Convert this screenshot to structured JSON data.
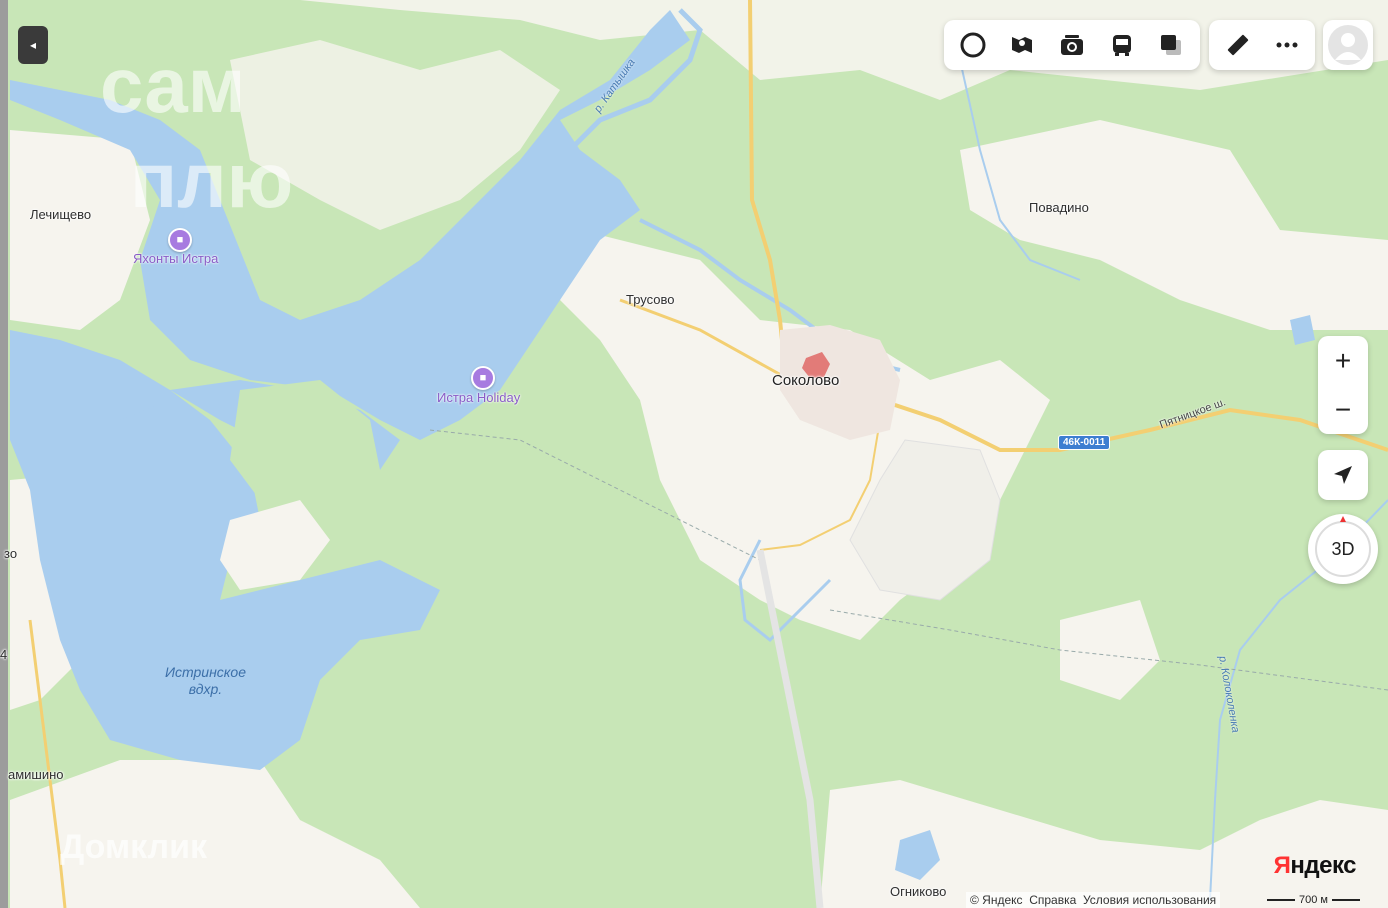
{
  "map": {
    "places": {
      "lechishchevo": "Лечищево",
      "trusovo": "Трусово",
      "sokolovo": "Соколово",
      "povadino": "Повадино",
      "ognikovo": "Огниково",
      "amishino": "амишино",
      "left_partial": "зо",
      "left_digit": "4"
    },
    "pois": {
      "yakhonty": "Яхонты Истра",
      "istra_holiday": "Истра Holiday"
    },
    "water": {
      "reservoir_line1": "Истринское",
      "reservoir_line2": "вдхр.",
      "river_katyshka": "р. Катышка",
      "river_kolokolenka": "р. Колоколенка"
    },
    "roads": {
      "pyatnitskoe": "Пятницкое ш.",
      "badge_46k": "46К-0011"
    },
    "watermarks": {
      "top_line1": "сам",
      "top_line2": "плю",
      "bottom": "Домклик"
    }
  },
  "toolbar": {
    "icons": [
      "alice-icon",
      "panorama-icon",
      "photo-icon",
      "transport-icon",
      "layers-icon"
    ],
    "ruler_icon": "ruler-icon",
    "more_icon": "more-icon",
    "profile_icon": "avatar"
  },
  "controls": {
    "zoom_in": "+",
    "zoom_out": "−",
    "mode_3d": "3D",
    "collapse": "◂"
  },
  "footer": {
    "copyright": "© Яндекс",
    "help": "Справка",
    "terms": "Условия использования",
    "brand": "Яндекс",
    "brand_first": "Я",
    "brand_rest": "ндекс",
    "scale": "700 м"
  },
  "colors": {
    "water": "#a9cdee",
    "forest": "#c5e6b4",
    "open_land": "#f7f5ef",
    "road_main": "#f3cf72",
    "accent_poi": "#a77be0"
  }
}
